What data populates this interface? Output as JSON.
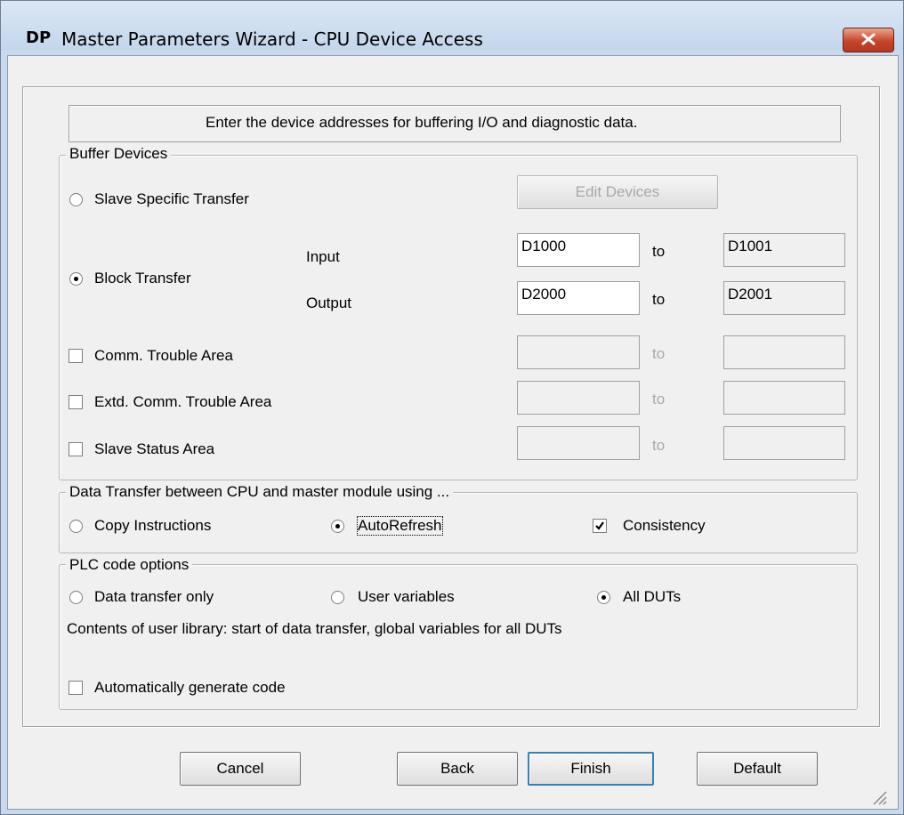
{
  "window": {
    "icon_text": "DP",
    "title": "Master Parameters Wizard - CPU Device Access",
    "close_icon": "close-x-icon"
  },
  "info_text": "Enter the device addresses for buffering I/O and diagnostic data.",
  "buffer_devices": {
    "legend": "Buffer Devices",
    "slave_specific_transfer": {
      "label": "Slave Specific Transfer",
      "selected": false
    },
    "edit_devices_button": "Edit Devices",
    "block_transfer": {
      "label": "Block Transfer",
      "selected": true
    },
    "input": {
      "label": "Input",
      "from": "D1000",
      "to_label": "to",
      "to": "D1001"
    },
    "output": {
      "label": "Output",
      "from": "D2000",
      "to_label": "to",
      "to": "D2001"
    },
    "comm_trouble_area": {
      "label": "Comm. Trouble Area",
      "checked": false,
      "from": "",
      "to_label": "to",
      "to": ""
    },
    "extd_comm_trouble_area": {
      "label": "Extd. Comm. Trouble Area",
      "checked": false,
      "from": "",
      "to_label": "to",
      "to": ""
    },
    "slave_status_area": {
      "label": "Slave Status Area",
      "checked": false,
      "from": "",
      "to_label": "to",
      "to": ""
    }
  },
  "data_transfer": {
    "legend": "Data Transfer between CPU and master module using ...",
    "copy_instructions": {
      "label": "Copy Instructions",
      "selected": false
    },
    "autorefresh": {
      "label": "AutoRefresh",
      "selected": true
    },
    "consistency": {
      "label": "Consistency",
      "checked": true
    }
  },
  "plc_code_options": {
    "legend": "PLC code options",
    "data_transfer_only": {
      "label": "Data transfer only",
      "selected": false
    },
    "user_variables": {
      "label": "User variables",
      "selected": false
    },
    "all_duts": {
      "label": "All DUTs",
      "selected": true
    },
    "contents_text": "Contents of user library: start of data transfer, global variables for all DUTs",
    "auto_generate": {
      "label": "Automatically generate code",
      "checked": false
    }
  },
  "buttons": {
    "cancel": "Cancel",
    "back": "Back",
    "finish": "Finish",
    "default": "Default"
  },
  "colors": {
    "close_button": "#c7442a",
    "default_button_border": "#3c7fb1",
    "disabled_text": "#a8a8a8"
  }
}
